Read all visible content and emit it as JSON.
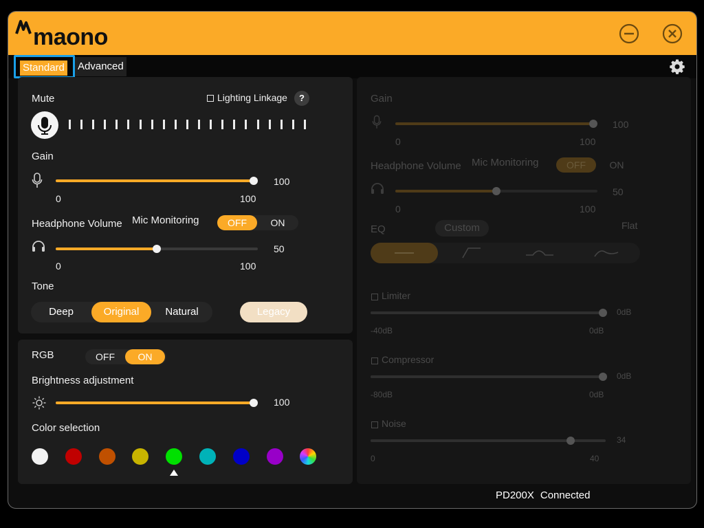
{
  "app": {
    "brand": "maono",
    "colors": {
      "accent": "#fbaa27",
      "background": "#0e0e0e",
      "panel": "#1d1d1d",
      "tab_focus": "#1aa0e8"
    },
    "window_buttons": {
      "minimize_icon": "minus-circle-icon",
      "close_icon": "close-circle-icon"
    }
  },
  "tabs": {
    "standard": "Standard",
    "advanced": "Advanced",
    "settings_icon": "gear-icon"
  },
  "audio": {
    "mute_label": "Mute",
    "lighting_linkage_label": "Lighting Linkage",
    "lighting_linkage_checked": false,
    "help_label": "?",
    "gain": {
      "label": "Gain",
      "value": "100",
      "min": "0",
      "max": "100",
      "level": 1.0
    },
    "headphone": {
      "label": "Headphone Volume",
      "value": "50",
      "min": "0",
      "max": "100",
      "level": 0.5
    },
    "mic_monitoring": {
      "label": "Mic Monitoring",
      "off": "OFF",
      "on": "ON",
      "selected": "OFF"
    },
    "tone": {
      "label": "Tone",
      "options": [
        "Deep",
        "Original",
        "Natural"
      ],
      "selected": "Original",
      "legacy": "Legacy"
    }
  },
  "rgb": {
    "label": "RGB",
    "off": "OFF",
    "on": "ON",
    "selected": "ON",
    "brightness": {
      "label": "Brightness adjustment",
      "value": "100",
      "level": 1.0
    },
    "color_selection_label": "Color selection",
    "colors": [
      "#f2f2f2",
      "#c00000",
      "#c05000",
      "#c8b400",
      "#00e000",
      "#00b2b8",
      "#0000c8",
      "#9800c8",
      "rainbow"
    ],
    "selected_index": 4
  },
  "advanced": {
    "gain": {
      "label": "Gain",
      "value": "100",
      "min": "0",
      "max": "100",
      "level": 1.0
    },
    "headphone": {
      "label": "Headphone Volume",
      "value": "50",
      "min": "0",
      "max": "100",
      "level": 0.5
    },
    "mic_monitoring": {
      "label": "Mic Monitoring",
      "off": "OFF",
      "on": "ON"
    },
    "eq": {
      "label": "EQ",
      "custom": "Custom",
      "flat": "Flat",
      "presets": [
        "flat-eq-icon",
        "high-pass-eq-icon",
        "mid-boost-eq-icon",
        "presence-eq-icon"
      ]
    },
    "limiter": {
      "label": "Limiter",
      "value": "0dB",
      "min": "-40dB",
      "max": "0dB",
      "level": 1.0
    },
    "compressor": {
      "label": "Compressor",
      "value": "0dB",
      "min": "-80dB",
      "max": "0dB",
      "level": 1.0
    },
    "noise": {
      "label": "Noise",
      "value": "34",
      "min": "0",
      "max": "40",
      "level": 0.85
    }
  },
  "status": {
    "device": "PD200X",
    "connection": "Connected"
  }
}
